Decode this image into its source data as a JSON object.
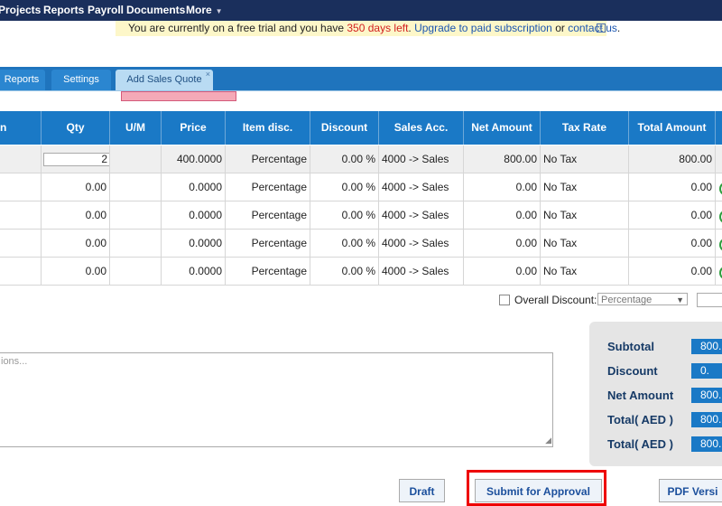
{
  "topnav": {
    "items": [
      "Projects",
      "Reports",
      "Payroll",
      "Documents",
      "More"
    ],
    "more_caret": "▼"
  },
  "trial_banner": {
    "prefix": "You are currently on a free trial and you have ",
    "days_left": "350 days left",
    "middle": ". ",
    "upgrade_link": "Upgrade to paid subscription",
    "or_text": " or ",
    "contact_link": "contact us",
    "suffix": ".",
    "close_icon": "×"
  },
  "tabs": [
    {
      "label": "Reports",
      "active": false
    },
    {
      "label": "Settings",
      "active": false
    },
    {
      "label": "Add Sales Quote",
      "active": true
    }
  ],
  "tab_close": "×",
  "table": {
    "columns": [
      "n",
      "Qty",
      "U/M",
      "Price",
      "Item disc.",
      "Discount",
      "Sales Acc.",
      "Net Amount",
      "Tax Rate",
      "Total Amount"
    ],
    "rows": [
      {
        "qty": "2",
        "um": "",
        "price": "400.0000",
        "item_disc": "Percentage",
        "discount": "0.00 %",
        "sales_acc": "4000 -> Sales",
        "net": "800.00",
        "tax": "No Tax",
        "total": "800.00"
      },
      {
        "qty": "0.00",
        "um": "",
        "price": "0.0000",
        "item_disc": "Percentage",
        "discount": "0.00 %",
        "sales_acc": "4000 -> Sales",
        "net": "0.00",
        "tax": "No Tax",
        "total": "0.00"
      },
      {
        "qty": "0.00",
        "um": "",
        "price": "0.0000",
        "item_disc": "Percentage",
        "discount": "0.00 %",
        "sales_acc": "4000 -> Sales",
        "net": "0.00",
        "tax": "No Tax",
        "total": "0.00"
      },
      {
        "qty": "0.00",
        "um": "",
        "price": "0.0000",
        "item_disc": "Percentage",
        "discount": "0.00 %",
        "sales_acc": "4000 -> Sales",
        "net": "0.00",
        "tax": "No Tax",
        "total": "0.00"
      },
      {
        "qty": "0.00",
        "um": "",
        "price": "0.0000",
        "item_disc": "Percentage",
        "discount": "0.00 %",
        "sales_acc": "4000 -> Sales",
        "net": "0.00",
        "tax": "No Tax",
        "total": "0.00"
      }
    ]
  },
  "overall_discount": {
    "label": "Overall Discount:",
    "select_value": "Percentage",
    "select_arrow": "▼"
  },
  "notes": {
    "placeholder": "ions..."
  },
  "totals": [
    {
      "label": "Subtotal",
      "value": "800."
    },
    {
      "label": "Discount",
      "value": "0."
    },
    {
      "label": "Net Amount",
      "value": "800."
    },
    {
      "label": "Total( AED )",
      "value": "800."
    },
    {
      "label": "Total( AED )",
      "value": "800."
    }
  ],
  "buttons": {
    "draft": "Draft",
    "submit": "Submit for Approval",
    "pdf": "PDF Versi"
  },
  "colors": {
    "nav_bg": "#1a2f5c",
    "header_blue": "#1a79c6",
    "highlight_red": "#e00000"
  }
}
